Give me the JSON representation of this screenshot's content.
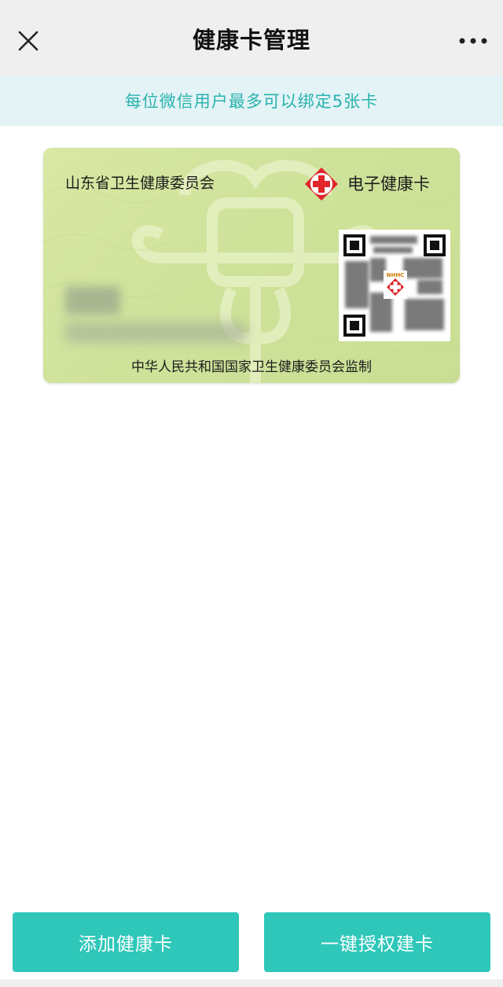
{
  "nav": {
    "title": "健康卡管理",
    "close_icon": "close-icon",
    "more_icon": "more-icon"
  },
  "notice": {
    "text": "每位微信用户最多可以绑定5张卡",
    "color": "#29b3ad"
  },
  "card": {
    "issuer": "山东省卫生健康委员会",
    "type": "电子健康卡",
    "supervisor": "中华人民共和国国家卫生健康委员会监制",
    "logo_icon": "red-cross-logo-icon",
    "qr_badge": "NHHC",
    "background_color": "#d4e59e",
    "logo_color": "#e0262b"
  },
  "actions": {
    "add_label": "添加健康卡",
    "auth_label": "一键授权建卡",
    "accent": "#2fc7b9"
  }
}
